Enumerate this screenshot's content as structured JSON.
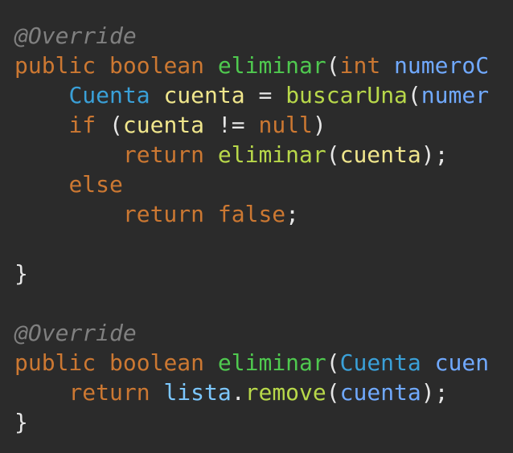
{
  "colors": {
    "background": "#2b2b2b",
    "annotation": "#808080",
    "keyword": "#cc7832",
    "method_declaration": "#4fc94f",
    "method_call": "#b8d84a",
    "parameter": "#70a9ff",
    "type": "#3aa0d8",
    "local_variable": "#f0e68c",
    "field": "#7cc7ff",
    "operator": "#e6e6e6"
  },
  "code": {
    "lines": [
      {
        "tokens": [
          {
            "t": "@Override",
            "k": "annotation"
          }
        ]
      },
      {
        "tokens": [
          {
            "t": "public",
            "k": "keyword"
          },
          {
            "t": " ",
            "k": "text"
          },
          {
            "t": "boolean",
            "k": "keyword"
          },
          {
            "t": " ",
            "k": "text"
          },
          {
            "t": "eliminar",
            "k": "method"
          },
          {
            "t": "(",
            "k": "punct"
          },
          {
            "t": "int",
            "k": "keyword"
          },
          {
            "t": " ",
            "k": "text"
          },
          {
            "t": "numeroC",
            "k": "param"
          }
        ]
      },
      {
        "tokens": [
          {
            "t": "    ",
            "k": "text"
          },
          {
            "t": "Cuenta",
            "k": "type"
          },
          {
            "t": " ",
            "k": "text"
          },
          {
            "t": "cuenta",
            "k": "local"
          },
          {
            "t": " ",
            "k": "text"
          },
          {
            "t": "=",
            "k": "op"
          },
          {
            "t": " ",
            "k": "text"
          },
          {
            "t": "buscarUna",
            "k": "call"
          },
          {
            "t": "(",
            "k": "punct"
          },
          {
            "t": "numer",
            "k": "param"
          }
        ]
      },
      {
        "tokens": [
          {
            "t": "    ",
            "k": "text"
          },
          {
            "t": "if",
            "k": "keyword"
          },
          {
            "t": " ",
            "k": "text"
          },
          {
            "t": "(",
            "k": "punct"
          },
          {
            "t": "cuenta",
            "k": "ident"
          },
          {
            "t": " ",
            "k": "text"
          },
          {
            "t": "!=",
            "k": "op"
          },
          {
            "t": " ",
            "k": "text"
          },
          {
            "t": "null",
            "k": "keyword"
          },
          {
            "t": ")",
            "k": "punct"
          }
        ]
      },
      {
        "tokens": [
          {
            "t": "        ",
            "k": "text"
          },
          {
            "t": "return",
            "k": "keyword"
          },
          {
            "t": " ",
            "k": "text"
          },
          {
            "t": "eliminar",
            "k": "call"
          },
          {
            "t": "(",
            "k": "punct"
          },
          {
            "t": "cuenta",
            "k": "ident"
          },
          {
            "t": ");",
            "k": "punct"
          }
        ]
      },
      {
        "tokens": [
          {
            "t": "    ",
            "k": "text"
          },
          {
            "t": "else",
            "k": "keyword"
          }
        ]
      },
      {
        "tokens": [
          {
            "t": "        ",
            "k": "text"
          },
          {
            "t": "return",
            "k": "keyword"
          },
          {
            "t": " ",
            "k": "text"
          },
          {
            "t": "false",
            "k": "keyword"
          },
          {
            "t": ";",
            "k": "punct"
          }
        ]
      },
      {
        "tokens": []
      },
      {
        "tokens": [
          {
            "t": "}",
            "k": "punct"
          }
        ]
      },
      {
        "tokens": []
      },
      {
        "tokens": [
          {
            "t": "@Override",
            "k": "annotation"
          }
        ]
      },
      {
        "tokens": [
          {
            "t": "public",
            "k": "keyword"
          },
          {
            "t": " ",
            "k": "text"
          },
          {
            "t": "boolean",
            "k": "keyword"
          },
          {
            "t": " ",
            "k": "text"
          },
          {
            "t": "eliminar",
            "k": "method"
          },
          {
            "t": "(",
            "k": "punct"
          },
          {
            "t": "Cuenta",
            "k": "type"
          },
          {
            "t": " ",
            "k": "text"
          },
          {
            "t": "cuen",
            "k": "param"
          }
        ]
      },
      {
        "tokens": [
          {
            "t": "    ",
            "k": "text"
          },
          {
            "t": "return",
            "k": "keyword"
          },
          {
            "t": " ",
            "k": "text"
          },
          {
            "t": "lista",
            "k": "field"
          },
          {
            "t": ".",
            "k": "punct"
          },
          {
            "t": "remove",
            "k": "call"
          },
          {
            "t": "(",
            "k": "punct"
          },
          {
            "t": "cuenta",
            "k": "param"
          },
          {
            "t": ");",
            "k": "punct"
          }
        ]
      },
      {
        "tokens": [
          {
            "t": "}",
            "k": "punct"
          }
        ]
      }
    ]
  }
}
